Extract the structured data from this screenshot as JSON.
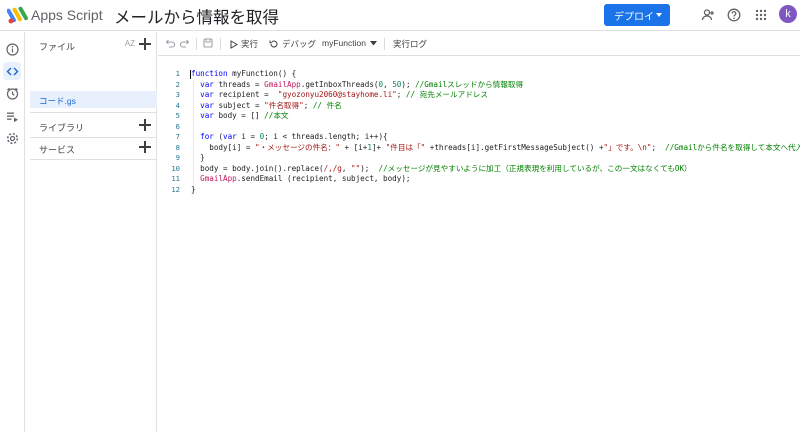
{
  "header": {
    "app_name": "Apps Script",
    "project_title": "メールから情報を取得",
    "deploy_label": "デプロイ",
    "avatar_letter": "k"
  },
  "sidebar": {
    "files_label": "ファイル",
    "sort_label": "AZ",
    "file_name": "コード.gs",
    "libraries_label": "ライブラリ",
    "services_label": "サービス"
  },
  "toolbar": {
    "run_label": "実行",
    "debug_label": "デバッグ",
    "function_select": "myFunction",
    "log_label": "実行ログ"
  },
  "editor": {
    "line_numbers": [
      "1",
      "2",
      "3",
      "4",
      "5",
      "6",
      "7",
      "8",
      "9",
      "10",
      "11",
      "12"
    ]
  },
  "colors": {
    "accent": "#1a73e8",
    "avatar": "#7e57c2",
    "active_file_bg": "#e8f0fe"
  },
  "icons": {
    "rail": [
      "info-icon",
      "code-icon",
      "clock-icon",
      "executions-icon",
      "gear-icon"
    ],
    "header": [
      "add-person-icon",
      "help-icon",
      "apps-grid-icon"
    ],
    "toolbar": [
      "undo-icon",
      "redo-icon",
      "save-icon",
      "run-icon",
      "debug-icon",
      "chevron-down-icon"
    ]
  }
}
